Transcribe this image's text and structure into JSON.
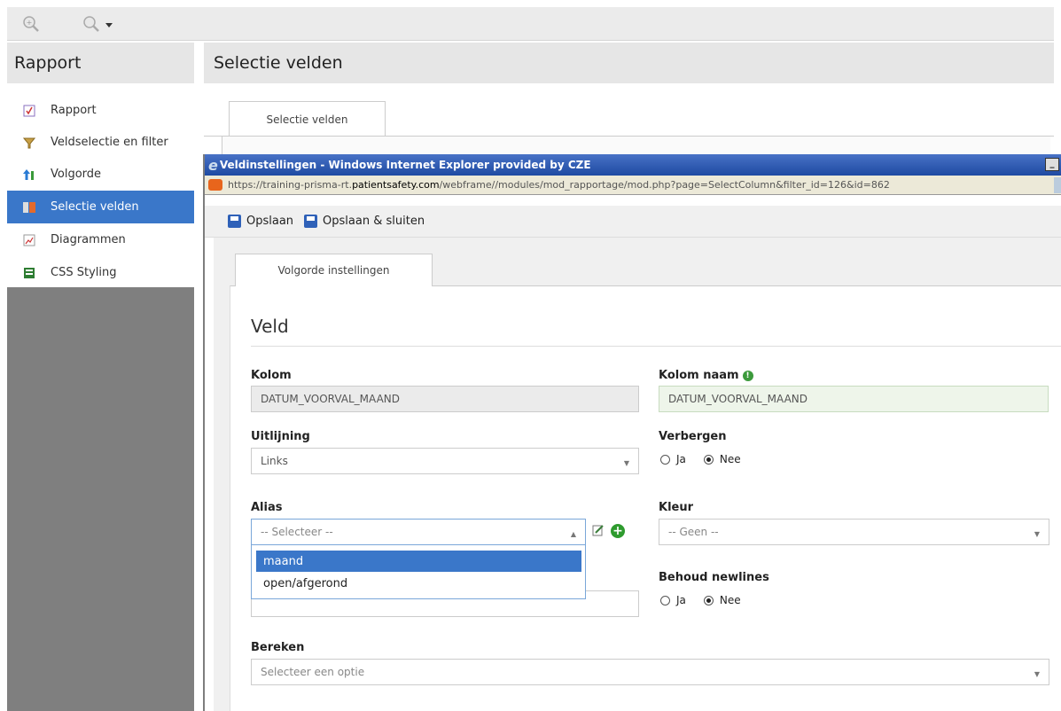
{
  "app": {
    "sidebar_title": "Rapport",
    "page_title": "Selectie velden",
    "tab_label": "Selectie velden",
    "sidebar_items": [
      {
        "label": "Rapport",
        "icon": "report-icon"
      },
      {
        "label": "Veldselectie en filter",
        "icon": "funnel-icon"
      },
      {
        "label": "Volgorde",
        "icon": "sort-arrows-icon"
      },
      {
        "label": "Selectie velden",
        "icon": "columns-icon",
        "active": true
      },
      {
        "label": "Diagrammen",
        "icon": "chart-icon"
      },
      {
        "label": "CSS Styling",
        "icon": "css-icon"
      }
    ]
  },
  "popup": {
    "window_title": "Veldinstellingen - Windows Internet Explorer provided by CZE",
    "url_prefix": "https://training-prisma-rt.",
    "url_domain": "patientsafety.com",
    "url_suffix": "/webframe//modules/mod_rapportage/mod.php?page=SelectColumn&filter_id=126&id=862",
    "toolbar": {
      "save_label": "Opslaan",
      "save_close_label": "Opslaan & sluiten"
    },
    "tab_label": "Volgorde instellingen",
    "section_title": "Veld",
    "fields": {
      "kolom_label": "Kolom",
      "kolom_value": "DATUM_VOORVAL_MAAND",
      "kolom_naam_label": "Kolom naam",
      "kolom_naam_value": "DATUM_VOORVAL_MAAND",
      "uitlijning_label": "Uitlijning",
      "uitlijning_value": "Links",
      "verbergen_label": "Verbergen",
      "verbergen_ja": "Ja",
      "verbergen_nee": "Nee",
      "verbergen_selected": "Nee",
      "alias_label": "Alias",
      "alias_placeholder": "-- Selecteer --",
      "alias_options": [
        "maand",
        "open/afgerond"
      ],
      "alias_highlighted": "maand",
      "kleur_label": "Kleur",
      "kleur_value": "-- Geen --",
      "behoud_label": "Behoud newlines",
      "behoud_ja": "Ja",
      "behoud_nee": "Nee",
      "behoud_selected": "Nee",
      "bereken_label": "Bereken",
      "bereken_placeholder": "Selecteer een optie"
    }
  },
  "colors": {
    "accent": "#3a77c9",
    "ie_titlebar": "#1e4aa2",
    "add_green": "#2e9b2e"
  }
}
